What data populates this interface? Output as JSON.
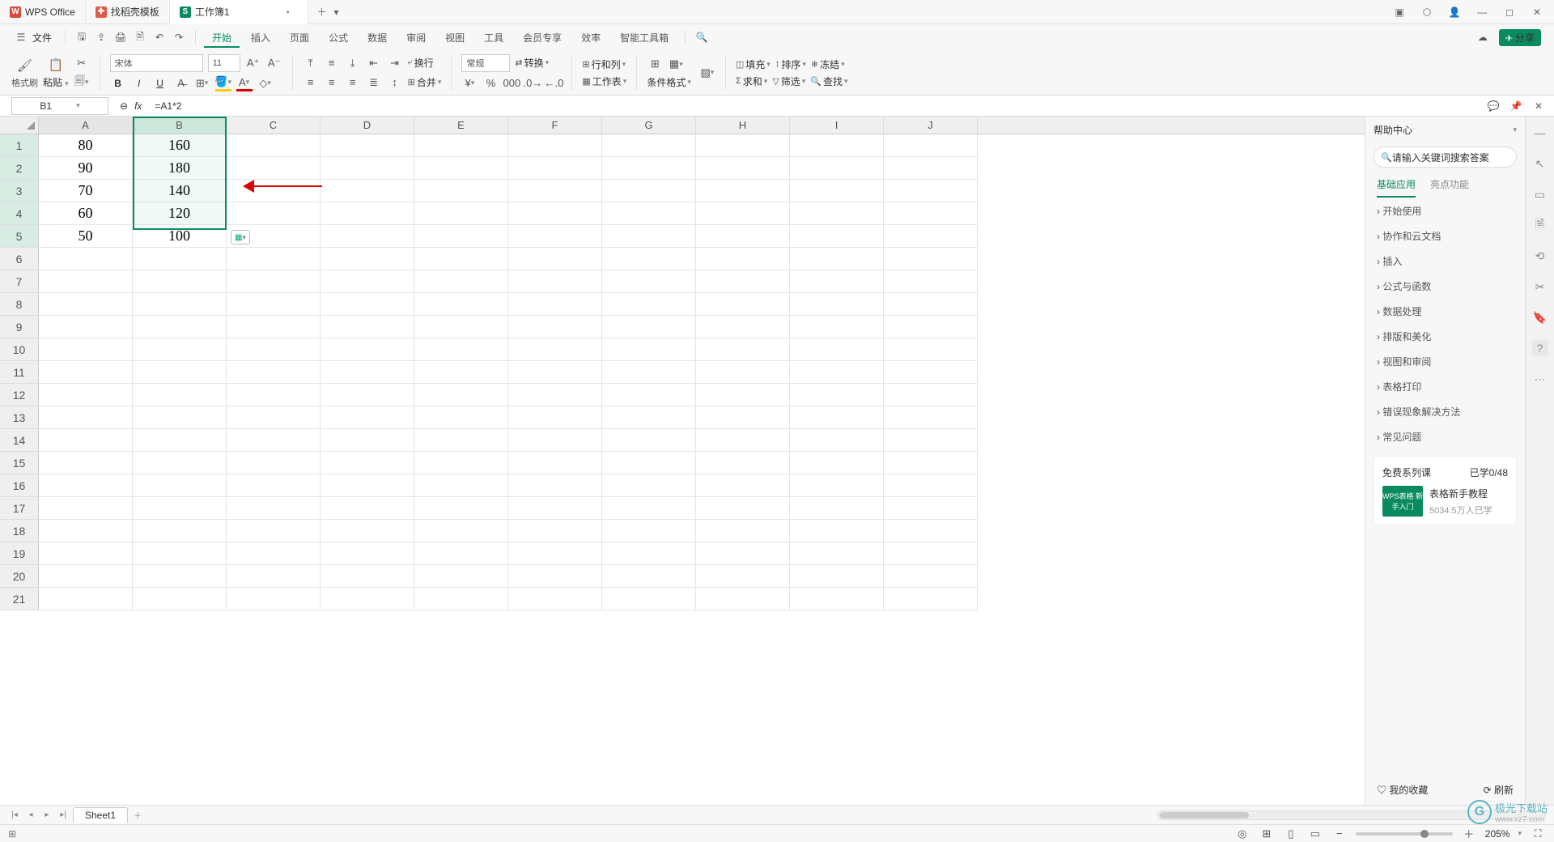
{
  "titlebar": {
    "tabs": [
      {
        "icon_bg": "#d94b3b",
        "icon_text": "W",
        "label": "WPS Office"
      },
      {
        "icon_bg": "#e05a4a",
        "icon_text": "✚",
        "label": "找稻壳模板"
      },
      {
        "icon_bg": "#0a8a5f",
        "icon_text": "S",
        "label": "工作簿1"
      }
    ]
  },
  "menubar": {
    "file": "文件",
    "items": [
      "开始",
      "插入",
      "页面",
      "公式",
      "数据",
      "审阅",
      "视图",
      "工具",
      "会员专享",
      "效率",
      "智能工具箱"
    ],
    "share": "分享"
  },
  "ribbon": {
    "format_brush": "格式刷",
    "paste": "粘贴",
    "font_name": "宋体",
    "font_size": "11",
    "general": "常规",
    "convert": "转换",
    "rowcol": "行和列",
    "worksheet": "工作表",
    "cond_fmt": "条件格式",
    "fill": "填充",
    "sort": "排序",
    "freeze": "冻结",
    "sum": "求和",
    "filter": "筛选",
    "find": "查找",
    "merge": "合并",
    "wrap": "换行"
  },
  "namebar": {
    "cell_ref": "B1",
    "formula": "=A1*2"
  },
  "columns": [
    "A",
    "B",
    "C",
    "D",
    "E",
    "F",
    "G",
    "H",
    "I",
    "J"
  ],
  "row_count": 21,
  "cells": {
    "A": [
      "80",
      "90",
      "70",
      "60",
      "50"
    ],
    "B": [
      "160",
      "180",
      "140",
      "120",
      "100"
    ]
  },
  "help": {
    "title": "帮助中心",
    "search_placeholder": "请输入关键词搜索答案",
    "tabs": [
      "基础应用",
      "亮点功能"
    ],
    "items": [
      "开始使用",
      "协作和云文档",
      "插入",
      "公式与函数",
      "数据处理",
      "排版和美化",
      "视图和审阅",
      "表格打印",
      "错误现象解决方法",
      "常见问题"
    ],
    "card_title": "免费系列课",
    "card_count": "已学0/48",
    "thumb": "WPS表格\n新手入门",
    "lesson_title": "表格新手教程",
    "lesson_sub": "5034.5万人已学",
    "fav": "我的收藏",
    "refresh": "刷新"
  },
  "tabbar": {
    "sheet": "Sheet1"
  },
  "statusbar": {
    "zoom": "205%"
  },
  "watermark": {
    "site": "极光下载站",
    "url": "www.xz7.com"
  },
  "chart_data": {
    "type": "table",
    "columns": [
      "A",
      "B"
    ],
    "rows": [
      [
        80,
        160
      ],
      [
        90,
        180
      ],
      [
        70,
        140
      ],
      [
        60,
        120
      ],
      [
        50,
        100
      ]
    ],
    "formula_B": "=A*2"
  }
}
